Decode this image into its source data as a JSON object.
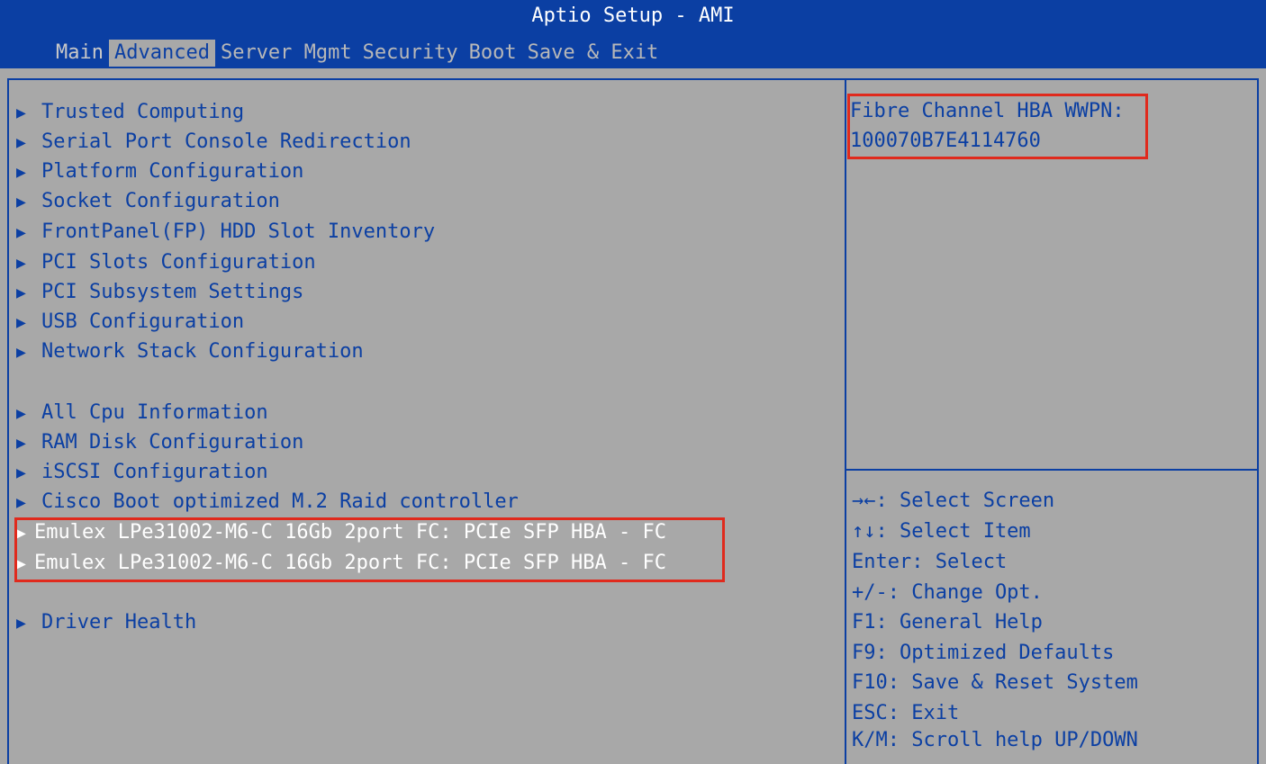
{
  "header": {
    "title": "Aptio Setup - AMI",
    "tabs": [
      "Main",
      "Advanced",
      "Server Mgmt",
      "Security",
      "Boot",
      "Save & Exit"
    ]
  },
  "menu": {
    "items": [
      "Trusted Computing",
      "Serial Port Console Redirection",
      "Platform Configuration",
      "Socket Configuration",
      "FrontPanel(FP) HDD Slot Inventory",
      "PCI Slots Configuration",
      "PCI Subsystem Settings",
      "USB Configuration",
      "Network Stack Configuration",
      "All Cpu Information",
      "RAM Disk Configuration",
      "iSCSI Configuration",
      "Cisco Boot optimized M.2 Raid controller",
      "Emulex LPe31002-M6-C 16Gb 2port FC: PCIe SFP HBA - FC",
      "Emulex LPe31002-M6-C 16Gb 2port FC: PCIe SFP HBA - FC",
      "Driver Health"
    ]
  },
  "help": {
    "line1": "Fibre Channel HBA WWPN:",
    "line2": "100070B7E4114760"
  },
  "keys": [
    "→←: Select Screen",
    "↑↓: Select Item",
    "Enter: Select",
    "+/-: Change Opt.",
    "F1: General Help",
    "F9: Optimized Defaults",
    "F10: Save & Reset System",
    "ESC: Exit",
    "K/M: Scroll help UP/DOWN"
  ],
  "colors": {
    "header_bg": "#0b3fa3",
    "body_bg": "#a8a8a8",
    "text_blue": "#0b3fa3",
    "highlight_red": "#e02a1d"
  }
}
